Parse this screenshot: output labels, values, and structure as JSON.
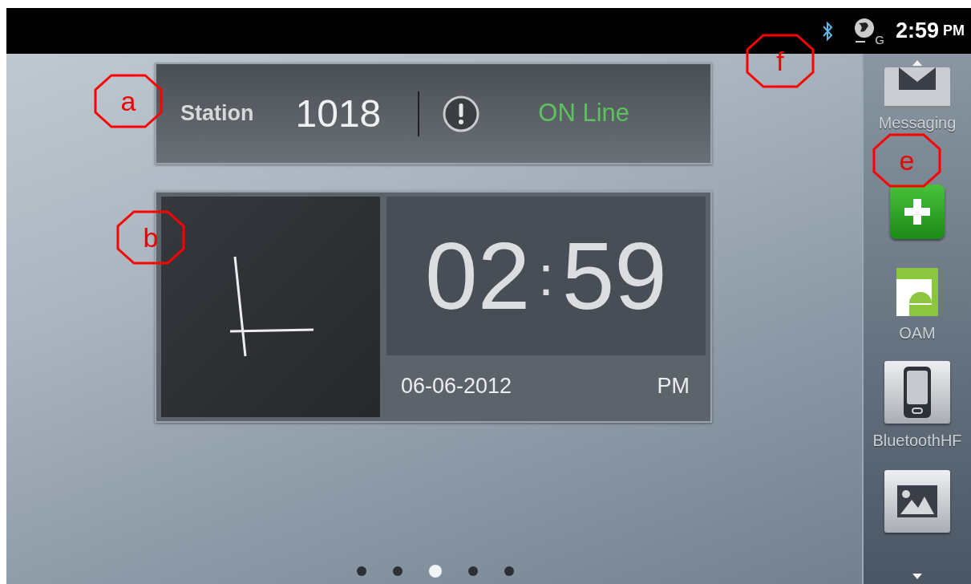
{
  "status_bar": {
    "network_type": "G",
    "time": "2:59",
    "ampm": "PM"
  },
  "station_widget": {
    "label": "Station",
    "number": "1018",
    "status": "ON Line"
  },
  "clock_widget": {
    "hours": "02",
    "separator": ":",
    "minutes": "59",
    "date": "06-06-2012",
    "ampm": "PM"
  },
  "dock": {
    "items": [
      {
        "kind": "messaging",
        "label": "Messaging"
      },
      {
        "kind": "plus"
      },
      {
        "kind": "oam",
        "label": "OAM"
      },
      {
        "kind": "phone",
        "label": "BluetoothHF"
      },
      {
        "kind": "gallery"
      }
    ]
  },
  "page_indicator": [
    {
      "selected": false
    },
    {
      "selected": false
    },
    {
      "selected": true
    },
    {
      "selected": false
    },
    {
      "selected": false
    }
  ],
  "callouts": [
    {
      "label": "a"
    },
    {
      "label": "b"
    },
    {
      "label": "e"
    },
    {
      "label": "f"
    }
  ]
}
